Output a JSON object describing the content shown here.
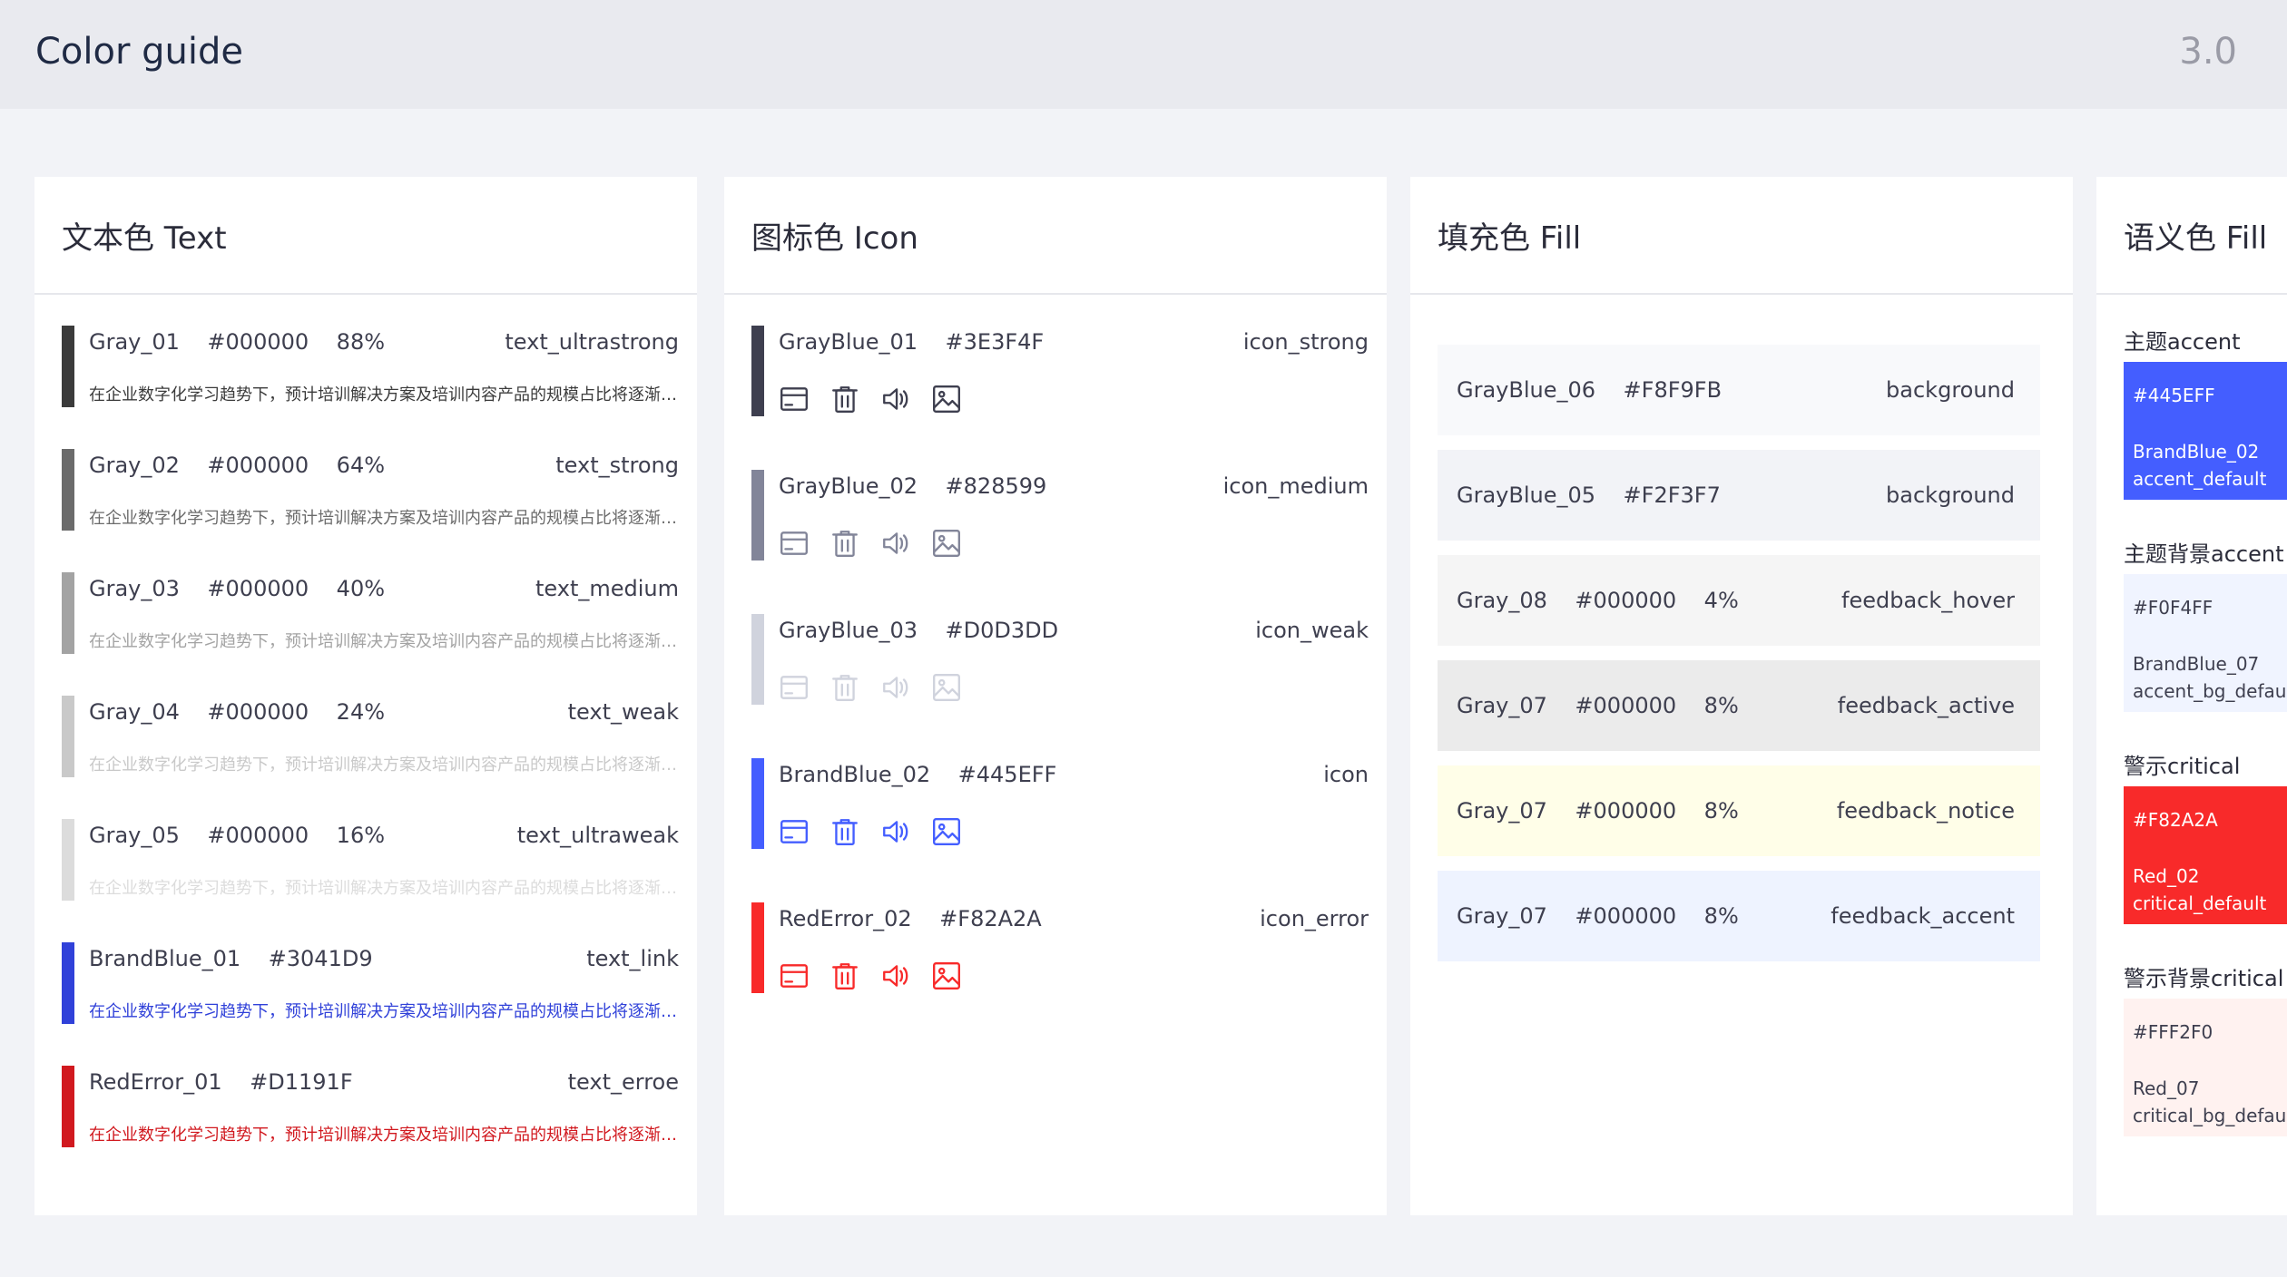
{
  "header": {
    "title": "Color guide",
    "version": "3.0"
  },
  "text_panel": {
    "title": "文本色 Text",
    "rows": [
      {
        "line": "Gray_01    #000000    88%",
        "token": "text_ultrastrong",
        "bar": "#3B3B3B",
        "sample": "在企业数字化学习趋势下，预计培训解决方案及培训内容产品的规模占比将逐渐增大",
        "sample_color": "#3B3B3B"
      },
      {
        "line": "Gray_02    #000000    64%",
        "token": "text_strong",
        "bar": "#6B6B6B",
        "sample": "在企业数字化学习趋势下，预计培训解决方案及培训内容产品的规模占比将逐渐增大",
        "sample_color": "#6B6B6B"
      },
      {
        "line": "Gray_03    #000000    40%",
        "token": "text_medium",
        "bar": "#A3A3A3",
        "sample": "在企业数字化学习趋势下，预计培训解决方案及培训内容产品的规模占比将逐渐增大",
        "sample_color": "#A3A3A3"
      },
      {
        "line": "Gray_04    #000000    24%",
        "token": "text_weak",
        "bar": "#C9C9C9",
        "sample": "在企业数字化学习趋势下，预计培训解决方案及培训内容产品的规模占比将逐渐增大",
        "sample_color": "#C9C9C9"
      },
      {
        "line": "Gray_05    #000000    16%",
        "token": "text_ultraweak",
        "bar": "#DCDCDC",
        "sample": "在企业数字化学习趋势下，预计培训解决方案及培训内容产品的规模占比将逐渐增大",
        "sample_color": "#DCDCDC"
      },
      {
        "line": "BrandBlue_01    #3041D9",
        "token": "text_link",
        "bar": "#3041D9",
        "sample": "在企业数字化学习趋势下，预计培训解决方案及培训内容产品的规模占比将逐渐增大",
        "sample_color": "#3041D9"
      },
      {
        "line": "RedError_01    #D1191F",
        "token": "text_erroe",
        "bar": "#D1191F",
        "sample": "在企业数字化学习趋势下，预计培训解决方案及培训内容产品的规模占比将逐渐增大",
        "sample_color": "#D1191F"
      }
    ]
  },
  "icon_panel": {
    "title": "图标色 Icon",
    "icon_names": [
      "window-icon",
      "trash-icon",
      "speaker-icon",
      "image-icon"
    ],
    "rows": [
      {
        "line": "GrayBlue_01    #3E3F4F",
        "token": "icon_strong",
        "color": "#3E3F4F"
      },
      {
        "line": "GrayBlue_02    #828599",
        "token": "icon_medium",
        "color": "#828599"
      },
      {
        "line": "GrayBlue_03    #D0D3DD",
        "token": "icon_weak",
        "color": "#D0D3DD"
      },
      {
        "line": "BrandBlue_02    #445EFF",
        "token": "icon",
        "color": "#445EFF"
      },
      {
        "line": "RedError_02    #F82A2A",
        "token": "icon_error",
        "color": "#F82A2A"
      }
    ]
  },
  "fill_panel": {
    "title": "填充色 Fill",
    "rows": [
      {
        "line": "GrayBlue_06    #F8F9FB",
        "token": "background",
        "fill": "#F8F9FB"
      },
      {
        "line": "GrayBlue_05    #F2F3F7",
        "token": "background",
        "fill": "#F2F3F7"
      },
      {
        "line": "Gray_08    #000000    4%",
        "token": "feedback_hover",
        "fill": "#F5F5F5"
      },
      {
        "line": "Gray_07    #000000    8%",
        "token": "feedback_active",
        "fill": "#EBEBEB"
      },
      {
        "line": "Gray_07    #000000    8%",
        "token": "feedback_notice",
        "fill": "#FFFEE8"
      },
      {
        "line": "Gray_07    #000000    8%",
        "token": "feedback_accent",
        "fill": "#EEF3FF"
      }
    ]
  },
  "semantic_panel": {
    "title": "语义色 Fill",
    "groups": [
      {
        "title": "主题accent",
        "hex": "#445EFF",
        "name": "BrandBlue_02",
        "token": "accent_default",
        "fill": "#445EFF",
        "text_color": "#FFFFFF",
        "edge": "#3041D9"
      },
      {
        "title": "主题背景accent",
        "hex": "#F0F4FF",
        "name": "BrandBlue_07",
        "token": "accent_bg_default",
        "fill": "#F0F4FF",
        "text_color": "#3E3F4F",
        "edge": "#F0F4FF"
      },
      {
        "title": "警示critical",
        "hex": "#F82A2A",
        "name": "Red_02",
        "token": "critical_default",
        "fill": "#F82A2A",
        "text_color": "#FFFFFF",
        "edge": "#D1191F"
      },
      {
        "title": "警示背景critical",
        "hex": "#FFF2F0",
        "name": "Red_07",
        "token": "critical_bg_default",
        "fill": "#FFF2F0",
        "text_color": "#3E3F4F",
        "edge": "#FFF2F0"
      }
    ]
  }
}
